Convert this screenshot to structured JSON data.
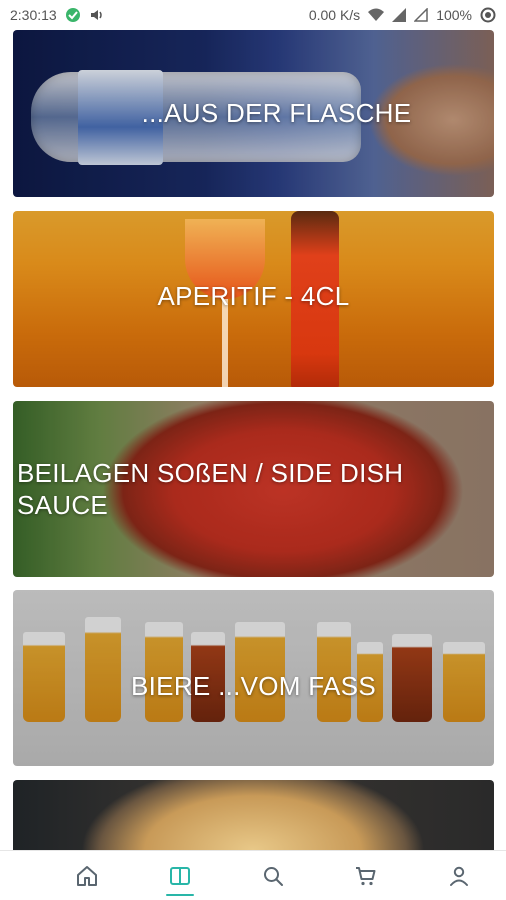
{
  "status_bar": {
    "time": "2:30:13",
    "net_speed": "0.00 K/s",
    "battery": "100%"
  },
  "cards": [
    {
      "title": "...AUS DER FLASCHE"
    },
    {
      "title": "APERITIF - 4CL"
    },
    {
      "title": "BEILAGEN SOßEN / SIDE DISH SAUCE"
    },
    {
      "title": "BIERE ...VOM FASS"
    },
    {
      "title": ""
    }
  ],
  "bottom_nav": {
    "items": [
      {
        "icon": "home-icon"
      },
      {
        "icon": "menu-book-icon",
        "active": true
      },
      {
        "icon": "search-icon"
      },
      {
        "icon": "cart-icon"
      },
      {
        "icon": "profile-icon"
      }
    ]
  },
  "colors": {
    "accent": "#29b6a8",
    "nav_icon": "#5a6670",
    "speaker_icon": "#1e3fbf"
  }
}
